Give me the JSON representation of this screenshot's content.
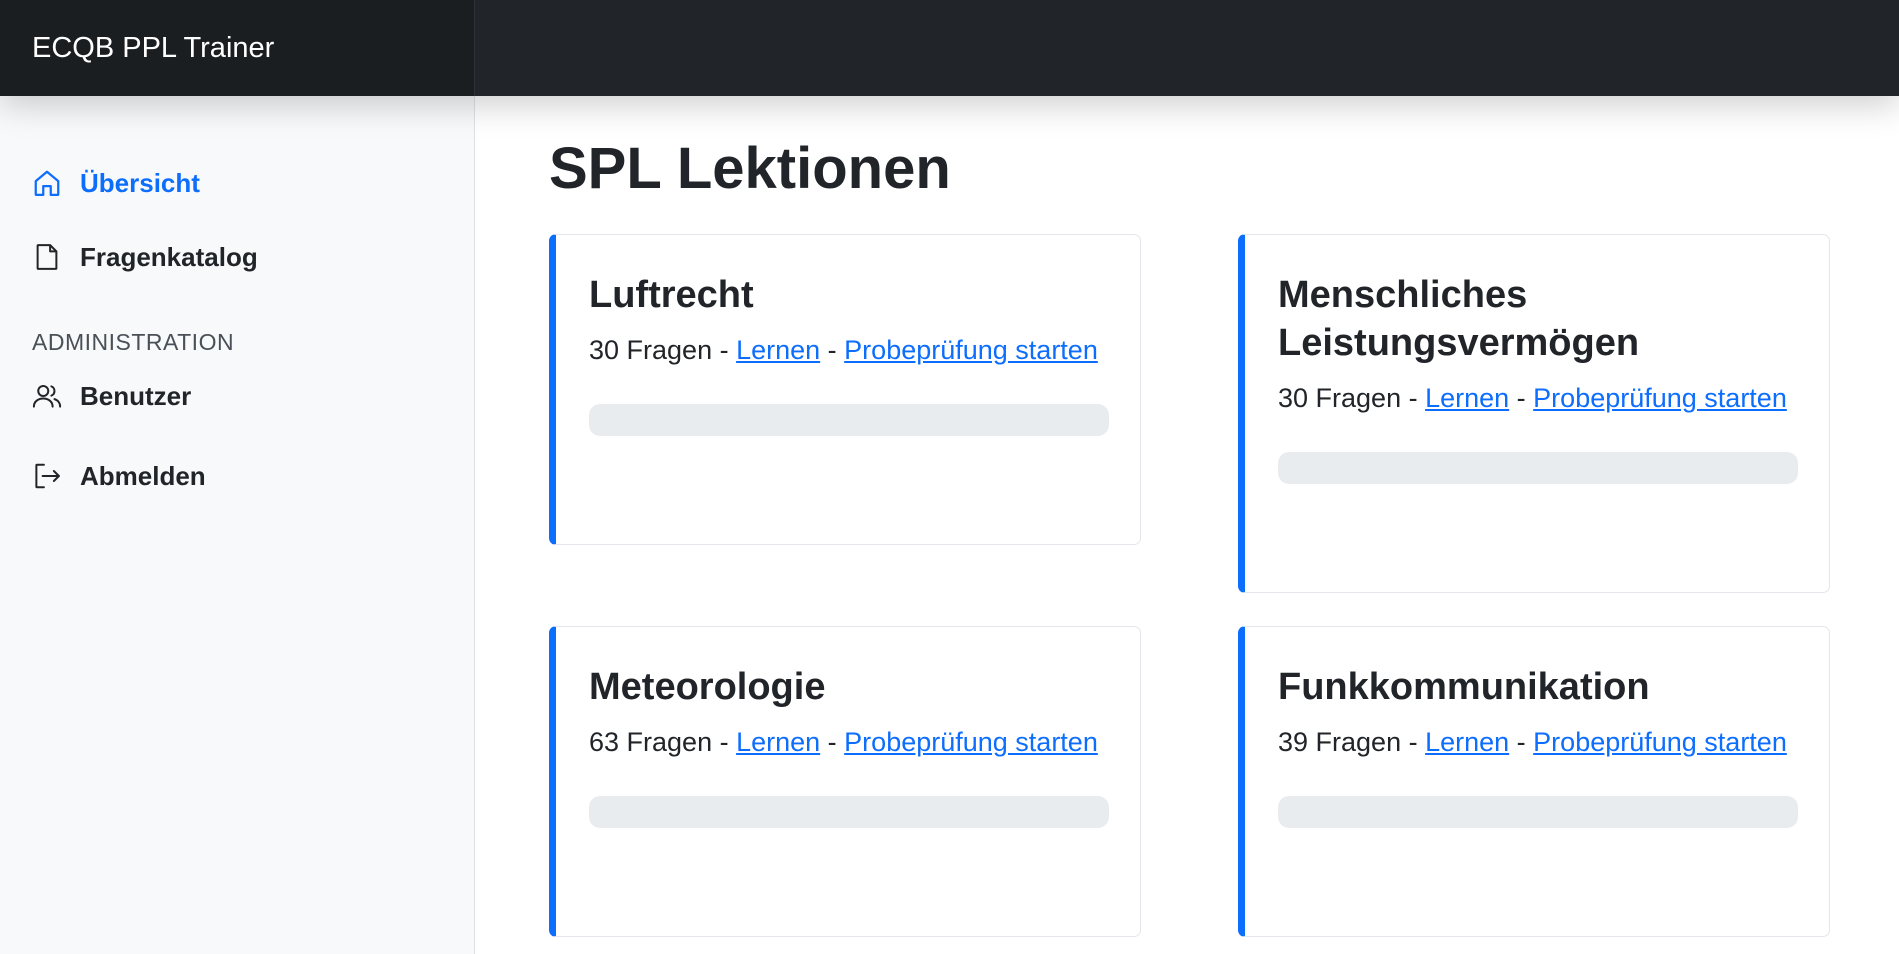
{
  "navbar": {
    "brand": "ECQB PPL Trainer"
  },
  "sidebar": {
    "items": [
      {
        "label": "Übersicht",
        "icon": "home-icon",
        "active": true
      },
      {
        "label": "Fragenkatalog",
        "icon": "file-icon",
        "active": false
      }
    ],
    "admin_heading": "ADMINISTRATION",
    "admin_items": [
      {
        "label": "Benutzer",
        "icon": "users-icon"
      }
    ],
    "logout": {
      "label": "Abmelden",
      "icon": "logout-icon"
    }
  },
  "main": {
    "title": "SPL Lektionen",
    "separator": " - ",
    "cards": [
      {
        "title": "Luftrecht",
        "count": "30 Fragen",
        "learn_label": "Lernen",
        "exam_label": "Probeprüfung starten",
        "progress": 0
      },
      {
        "title": "Menschliches Leistungsvermögen",
        "count": "30 Fragen",
        "learn_label": "Lernen",
        "exam_label": "Probeprüfung starten",
        "progress": 0
      },
      {
        "title": "Meteorologie",
        "count": "63 Fragen",
        "learn_label": "Lernen",
        "exam_label": "Probeprüfung starten",
        "progress": 0
      },
      {
        "title": "Funkkommunikation",
        "count": "39 Fragen",
        "learn_label": "Lernen",
        "exam_label": "Probeprüfung starten",
        "progress": 0
      }
    ]
  },
  "colors": {
    "accent": "#0d6efd",
    "navbar_bg": "#212529",
    "sidebar_bg": "#f8f9fa",
    "progress_track": "#e9ecef"
  }
}
